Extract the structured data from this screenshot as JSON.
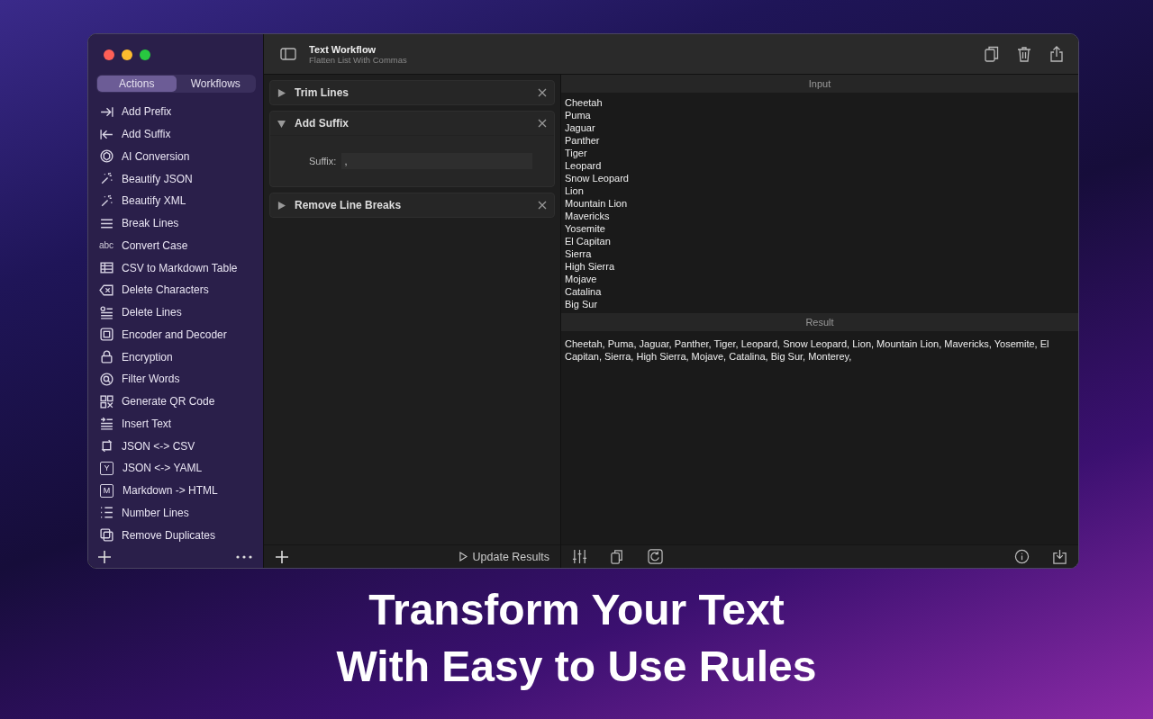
{
  "window": {
    "title": "Text Workflow",
    "subtitle": "Flatten List With Commas"
  },
  "sidebar": {
    "tabs": [
      {
        "label": "Actions",
        "selected": true
      },
      {
        "label": "Workflows",
        "selected": false
      }
    ],
    "items": [
      {
        "label": "Add Prefix"
      },
      {
        "label": "Add Suffix"
      },
      {
        "label": "AI Conversion"
      },
      {
        "label": "Beautify JSON"
      },
      {
        "label": "Beautify XML"
      },
      {
        "label": "Break Lines"
      },
      {
        "label": "Convert Case",
        "glyph": "abc"
      },
      {
        "label": "CSV to Markdown Table"
      },
      {
        "label": "Delete Characters"
      },
      {
        "label": "Delete Lines"
      },
      {
        "label": "Encoder and Decoder"
      },
      {
        "label": "Encryption"
      },
      {
        "label": "Filter Words"
      },
      {
        "label": "Generate QR Code"
      },
      {
        "label": "Insert Text"
      },
      {
        "label": "JSON <-> CSV"
      },
      {
        "label": "JSON <-> YAML",
        "glyph": "Y"
      },
      {
        "label": "Markdown -> HTML",
        "glyph": "M"
      },
      {
        "label": "Number Lines"
      },
      {
        "label": "Remove Duplicates"
      }
    ]
  },
  "steps": [
    {
      "title": "Trim Lines",
      "expanded": false
    },
    {
      "title": "Add Suffix",
      "expanded": true,
      "field_label": "Suffix:",
      "field_value": ","
    },
    {
      "title": "Remove Line Breaks",
      "expanded": false
    }
  ],
  "update_button": "Update Results",
  "input": {
    "header": "Input",
    "lines": [
      "Cheetah",
      "Puma",
      "Jaguar",
      "Panther",
      "Tiger",
      "Leopard",
      "Snow Leopard",
      "Lion",
      "Mountain Lion",
      "Mavericks",
      "Yosemite",
      "El Capitan",
      "Sierra",
      "High Sierra",
      "Mojave",
      "Catalina",
      "Big Sur"
    ]
  },
  "result": {
    "header": "Result",
    "text": "Cheetah, Puma, Jaguar, Panther, Tiger, Leopard, Snow Leopard, Lion, Mountain Lion, Mavericks, Yosemite, El Capitan, Sierra, High Sierra, Mojave, Catalina, Big Sur, Monterey,"
  },
  "headline": [
    "Transform Your Text",
    "With Easy to Use Rules"
  ]
}
